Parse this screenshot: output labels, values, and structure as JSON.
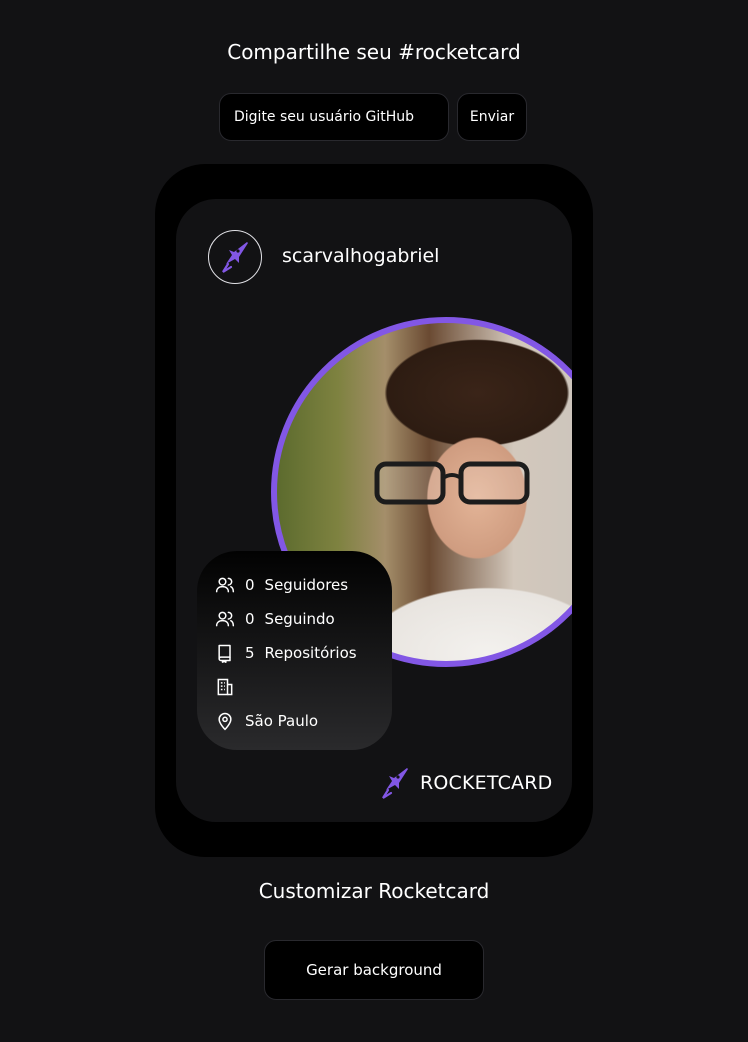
{
  "header": {
    "title": "Compartilhe seu #rocketcard"
  },
  "search": {
    "placeholder": "Digite seu usuário GitHub",
    "value": "",
    "button_label": "Enviar"
  },
  "card": {
    "username": "scarvalhogabriel",
    "stats": [
      {
        "icon": "users-icon",
        "value": "0",
        "label": "Seguidores"
      },
      {
        "icon": "users-icon",
        "value": "0",
        "label": "Seguindo"
      },
      {
        "icon": "book-icon",
        "value": "5",
        "label": "Repositórios"
      },
      {
        "icon": "building-icon",
        "value": "",
        "label": ""
      },
      {
        "icon": "map-pin-icon",
        "value": "",
        "label": "São Paulo"
      }
    ],
    "brand": "ROCKETCARD",
    "accent_color": "#8257e5"
  },
  "customize": {
    "title": "Customizar Rocketcard",
    "button_label": "Gerar background"
  }
}
